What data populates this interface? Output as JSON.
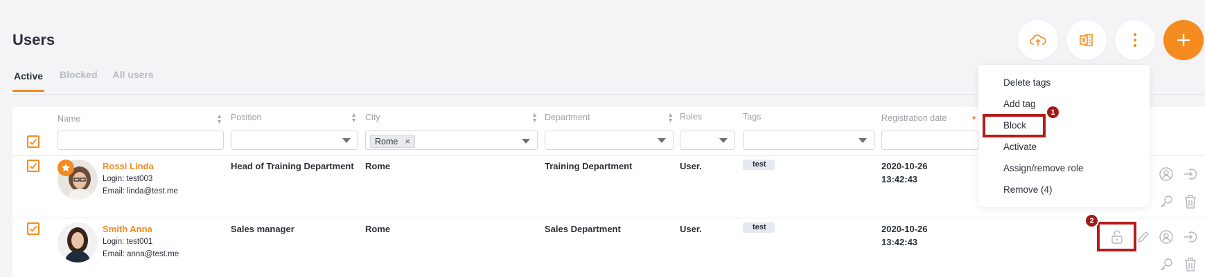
{
  "page": {
    "title": "Users"
  },
  "tabs": [
    {
      "label": "Active",
      "active": true
    },
    {
      "label": "Blocked",
      "active": false
    },
    {
      "label": "All users",
      "active": false
    }
  ],
  "toolbar": {
    "icons": [
      "cloud-upload-icon",
      "excel-export-icon",
      "more-vertical-icon",
      "plus-icon"
    ],
    "accent": "#f58a1f"
  },
  "table": {
    "columns": [
      "Name",
      "Position",
      "City",
      "Department",
      "Roles",
      "Tags",
      "Registration date"
    ],
    "filters": {
      "city_chip": "Rome",
      "city_chip_remove": "×"
    },
    "rows": [
      {
        "name": "Rossi Linda",
        "login": "Login: test003",
        "email": "Email: linda@test.me",
        "position": "Head of Training Department",
        "city": "Rome",
        "department": "Training Department",
        "roles": "User.",
        "tag": "test",
        "reg_date": "2020-10-26",
        "reg_time": "13:42:43",
        "starred": true
      },
      {
        "name": "Smith Anna",
        "login": "Login: test001",
        "email": "Email: anna@test.me",
        "position": "Sales manager",
        "city": "Rome",
        "department": "Sales Department",
        "roles": "User.",
        "tag": "test",
        "reg_date": "2020-10-26",
        "reg_time": "13:42:43",
        "starred": false
      }
    ]
  },
  "menu": {
    "items": [
      "Delete tags",
      "Add tag",
      "Block",
      "Activate",
      "Assign/remove role",
      "Remove (4)"
    ]
  },
  "annotations": {
    "badge1": "1",
    "badge2": "2",
    "highlight_color": "#b31b1b"
  }
}
